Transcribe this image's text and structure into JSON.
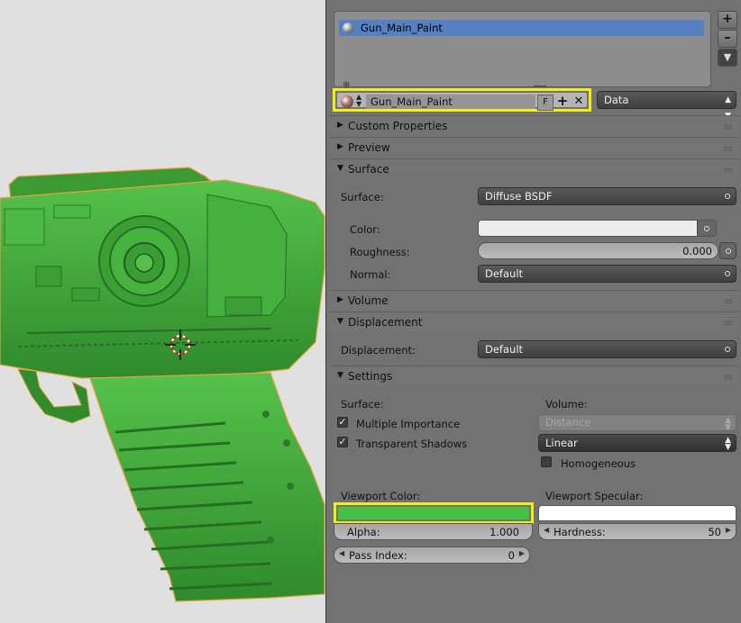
{
  "material_slots": [
    {
      "name": "Gun_Main_Paint"
    }
  ],
  "material_selector": {
    "name": "Gun_Main_Paint",
    "fake_user_label": "F"
  },
  "link_dropdown": {
    "value": "Data"
  },
  "sections": {
    "custom_properties": "Custom Properties",
    "preview": "Preview",
    "surface": "Surface",
    "volume": "Volume",
    "displacement": "Displacement",
    "settings": "Settings"
  },
  "surface": {
    "surface_label": "Surface:",
    "surface_value": "Diffuse BSDF",
    "color_label": "Color:",
    "color_value": "#ececec",
    "roughness_label": "Roughness:",
    "roughness_value": "0.000",
    "normal_label": "Normal:",
    "normal_value": "Default"
  },
  "displacement": {
    "label": "Displacement:",
    "value": "Default"
  },
  "settings": {
    "surface_label": "Surface:",
    "volume_label": "Volume:",
    "multiple_importance": {
      "label": "Multiple Importance",
      "checked": true
    },
    "transparent_shadows": {
      "label": "Transparent Shadows",
      "checked": true
    },
    "volume_sampling": "Distance",
    "volume_interpolation": "Linear",
    "homogeneous": {
      "label": "Homogeneous",
      "checked": false
    },
    "viewport_color_label": "Viewport Color:",
    "viewport_color": "#44c246",
    "viewport_specular_label": "Viewport Specular:",
    "viewport_specular": "#ffffff",
    "alpha_label": "Alpha:",
    "alpha_value": "1.000",
    "hardness_label": "Hardness:",
    "hardness_value": "50",
    "pass_index_label": "Pass Index:",
    "pass_index_value": "0"
  },
  "colors": {
    "panel": "#727272",
    "viewport_bg": "#e0e0e0",
    "highlight": "#f1ee15",
    "selection": "#5680c2",
    "model_green": "#3fa83a"
  },
  "icons": [
    "material-sphere-icon",
    "plus-icon",
    "minus-icon",
    "down-arrow-icon",
    "close-icon",
    "checkmark-icon",
    "3d-cursor-icon"
  ]
}
